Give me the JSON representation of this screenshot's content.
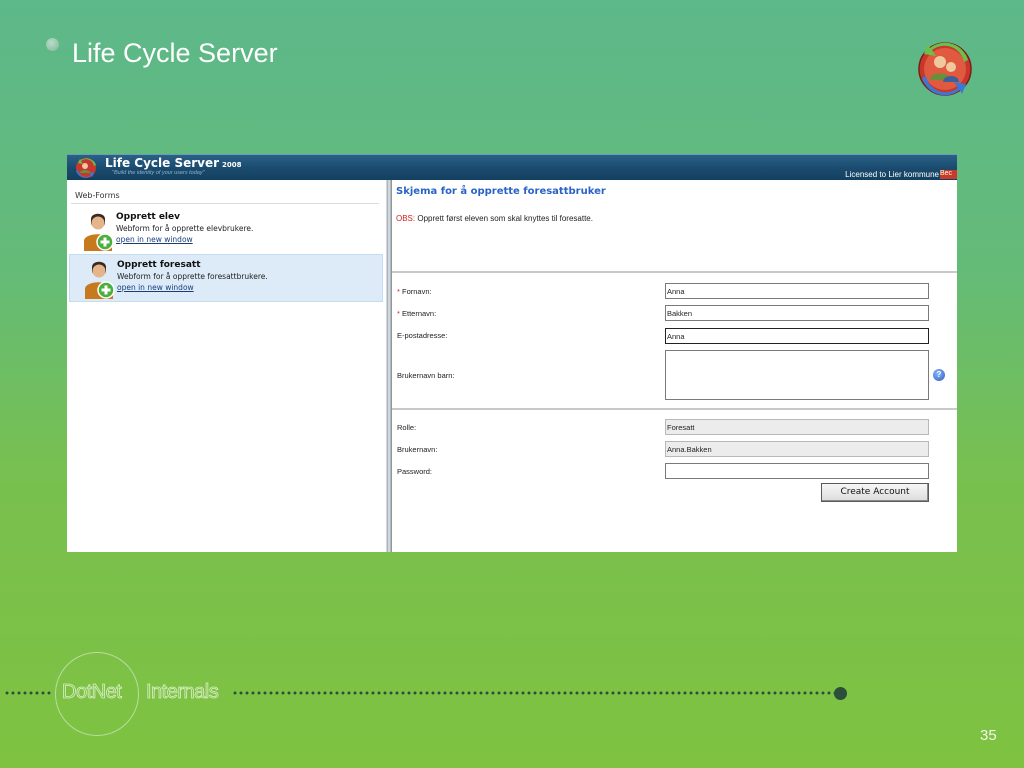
{
  "slide": {
    "title": "Life Cycle Server",
    "page_number": "35",
    "footer_brand_1": "DotNet",
    "footer_brand_2": "Internals"
  },
  "app": {
    "name": "Life Cycle Server",
    "year": "2008",
    "tagline": "\"Build the identity of your users today\"",
    "license_text": "Licensed to Lier kommune",
    "license_badge": "Bec"
  },
  "left_pane": {
    "title": "Web-Forms",
    "items": [
      {
        "name": "Opprett elev",
        "description": "Webform for å opprette elevbrukere.",
        "link": "open in new window"
      },
      {
        "name": "Opprett foresatt",
        "description": "Webform for å opprette foresattbrukere.",
        "link": "open in new window"
      }
    ]
  },
  "form": {
    "title": "Skjema for å opprette foresattbruker",
    "obs_label": "OBS:",
    "obs_text": " Opprett først eleven som skal knyttes til foresatte.",
    "required_mark": "*",
    "fields": {
      "fornavn": {
        "label": " Fornavn:",
        "value": "Anna"
      },
      "etternavn": {
        "label": " Etternavn:",
        "value": "Bakken"
      },
      "epost": {
        "label": "E-postadresse:",
        "value": "Anna"
      },
      "brukernavn_barn": {
        "label": "Brukernavn barn:",
        "value": ""
      },
      "rolle": {
        "label": "Rolle:",
        "value": "Foresatt"
      },
      "brukernavn": {
        "label": "Brukernavn:",
        "value": "Anna.Bakken"
      },
      "password": {
        "label": "Password:",
        "value": ""
      }
    },
    "help_icon_glyph": "?",
    "submit_label": "Create Account"
  },
  "colors": {
    "header_bar": "#1a4a6e",
    "form_title": "#2a63c8",
    "required": "#d12020",
    "slide_bg_top": "#5db88a",
    "slide_bg_bottom": "#7fc241"
  }
}
